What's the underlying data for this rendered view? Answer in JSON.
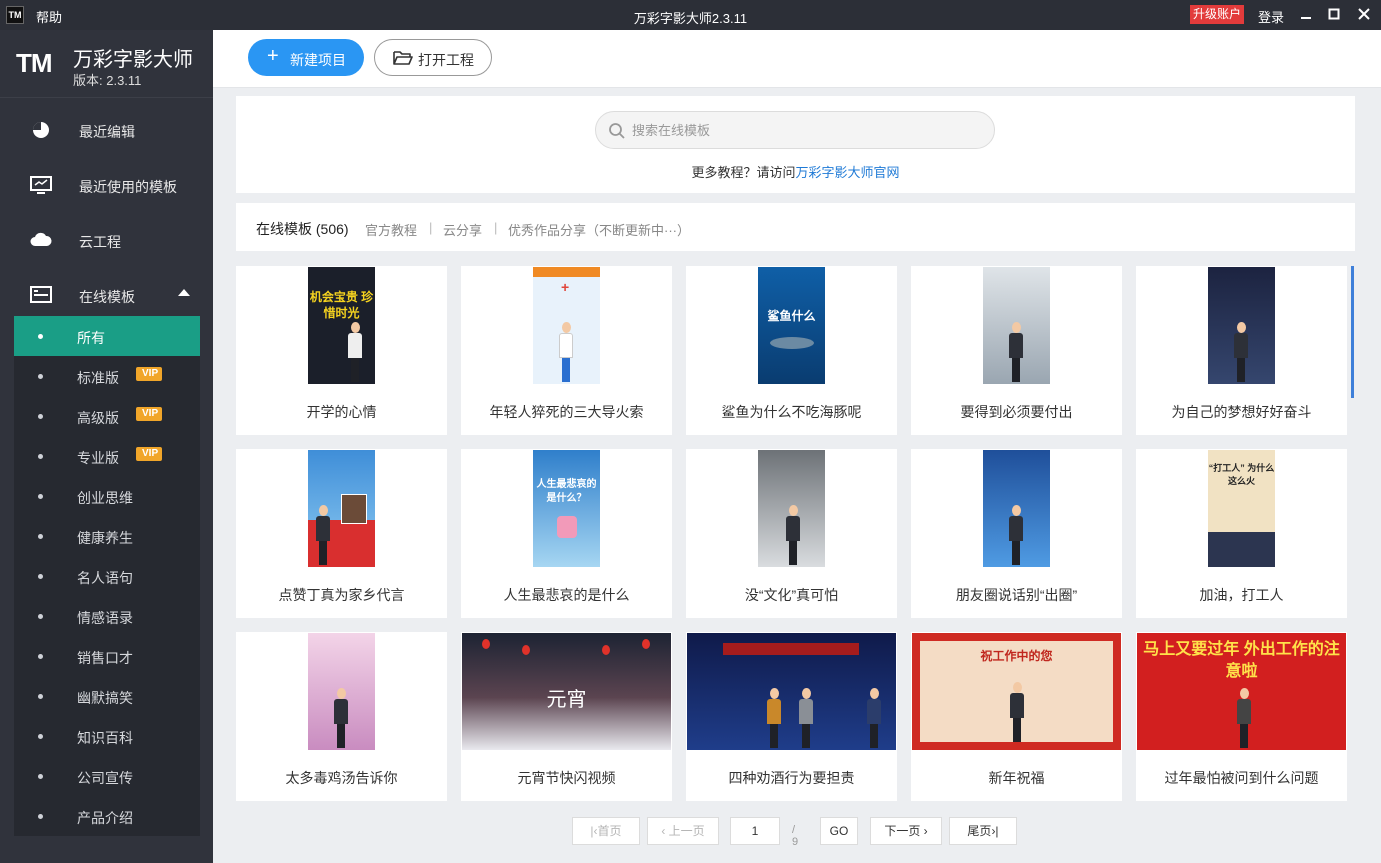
{
  "app": {
    "logo": "TM",
    "help": "帮助",
    "window_title": "万彩字影大师2.3.11",
    "upgrade": "升级账户",
    "login": "登录"
  },
  "brand": {
    "logo": "TM",
    "name": "万彩字影大师",
    "version": "版本: 2.3.11"
  },
  "nav": [
    {
      "label": "最近编辑",
      "icon": "pie-clock-icon"
    },
    {
      "label": "最近使用的模板",
      "icon": "monitor-icon"
    },
    {
      "label": "云工程",
      "icon": "cloud-icon"
    },
    {
      "label": "在线模板",
      "icon": "template-icon",
      "expanded": true
    }
  ],
  "subnav": [
    {
      "label": "所有",
      "active": true
    },
    {
      "label": "标准版",
      "vip": "VIP"
    },
    {
      "label": "高级版",
      "vip": "VIP"
    },
    {
      "label": "专业版",
      "vip": "VIP"
    },
    {
      "label": "创业思维"
    },
    {
      "label": "健康养生"
    },
    {
      "label": "名人语句"
    },
    {
      "label": "情感语录"
    },
    {
      "label": "销售口才"
    },
    {
      "label": "幽默搞笑"
    },
    {
      "label": "知识百科"
    },
    {
      "label": "公司宣传"
    },
    {
      "label": "产品介绍"
    }
  ],
  "toolbar": {
    "new_project": "新建项目",
    "open_project": "打开工程"
  },
  "search": {
    "placeholder": "搜索在线模板",
    "tutorial_prefix": "更多教程？请访问",
    "tutorial_link": "万彩字影大师官网"
  },
  "tabs": {
    "online": "在线模板 (506)",
    "official": "官方教程",
    "cloud": "云分享",
    "showcase": "优秀作品分享（不断更新中···）",
    "sep": "|"
  },
  "templates": [
    {
      "title": "开学的心情",
      "thumb_text": "机会宝贵 珍惜时光",
      "bg": "#1b1f2a",
      "fg": "#f5d21f"
    },
    {
      "title": "年轻人猝死的三大导火索",
      "thumb_text": "",
      "bg": "#e8f2fb",
      "fg": "#e0463b"
    },
    {
      "title": "鲨鱼为什么不吃海豚呢",
      "thumb_text": "鲨鱼什么",
      "bg": "#0f5fa7",
      "fg": "#ffffff"
    },
    {
      "title": "要得到必须要付出",
      "thumb_text": "",
      "bg": "#b7c2cc",
      "fg": "#5b6470"
    },
    {
      "title": "为自己的梦想好好奋斗",
      "thumb_text": "",
      "bg": "#1c2340",
      "fg": "#ffffff"
    },
    {
      "title": "点赞丁真为家乡代言",
      "thumb_text": "",
      "bg": "#3f8ed8",
      "fg": "#ffffff"
    },
    {
      "title": "人生最悲哀的是什么",
      "thumb_text": "人生最悲哀的 是什么？",
      "bg": "#4aa3de",
      "fg": "#ffffff"
    },
    {
      "title": "没“文化”真可怕",
      "thumb_text": "",
      "bg": "#9ea3a8",
      "fg": "#333333"
    },
    {
      "title": "朋友圈说话别“出圈”",
      "thumb_text": "",
      "bg": "#1f4f9a",
      "fg": "#ffe54d"
    },
    {
      "title": "加油，打工人",
      "thumb_text": "“打工人” 为什么这么火",
      "bg": "#f1e2c3",
      "fg": "#222222"
    },
    {
      "title": "太多毒鸡汤告诉你",
      "thumb_text": "",
      "bg": "#e8b8d6",
      "fg": "#333333"
    },
    {
      "title": "元宵节快闪视频",
      "thumb_text": "元宵",
      "bg": "#4a3a4a",
      "fg": "#ffffff"
    },
    {
      "title": "四种劝酒行为要担责",
      "thumb_text": "",
      "bg": "#0f1a4a",
      "fg": "#ff3b3b"
    },
    {
      "title": "新年祝福",
      "thumb_text": "祝工作中的您",
      "bg": "#f4dcc5",
      "fg": "#c0271e"
    },
    {
      "title": "过年最怕被问到什么问题",
      "thumb_text": "马上又要过年 外出工作的注意啦",
      "bg": "#d21f1f",
      "fg": "#ffe24a"
    }
  ],
  "pager": {
    "first": "首页",
    "prev": "上一页",
    "current": "1",
    "total": "/ 9",
    "go": "GO",
    "next": "下一页",
    "last": "尾页"
  }
}
